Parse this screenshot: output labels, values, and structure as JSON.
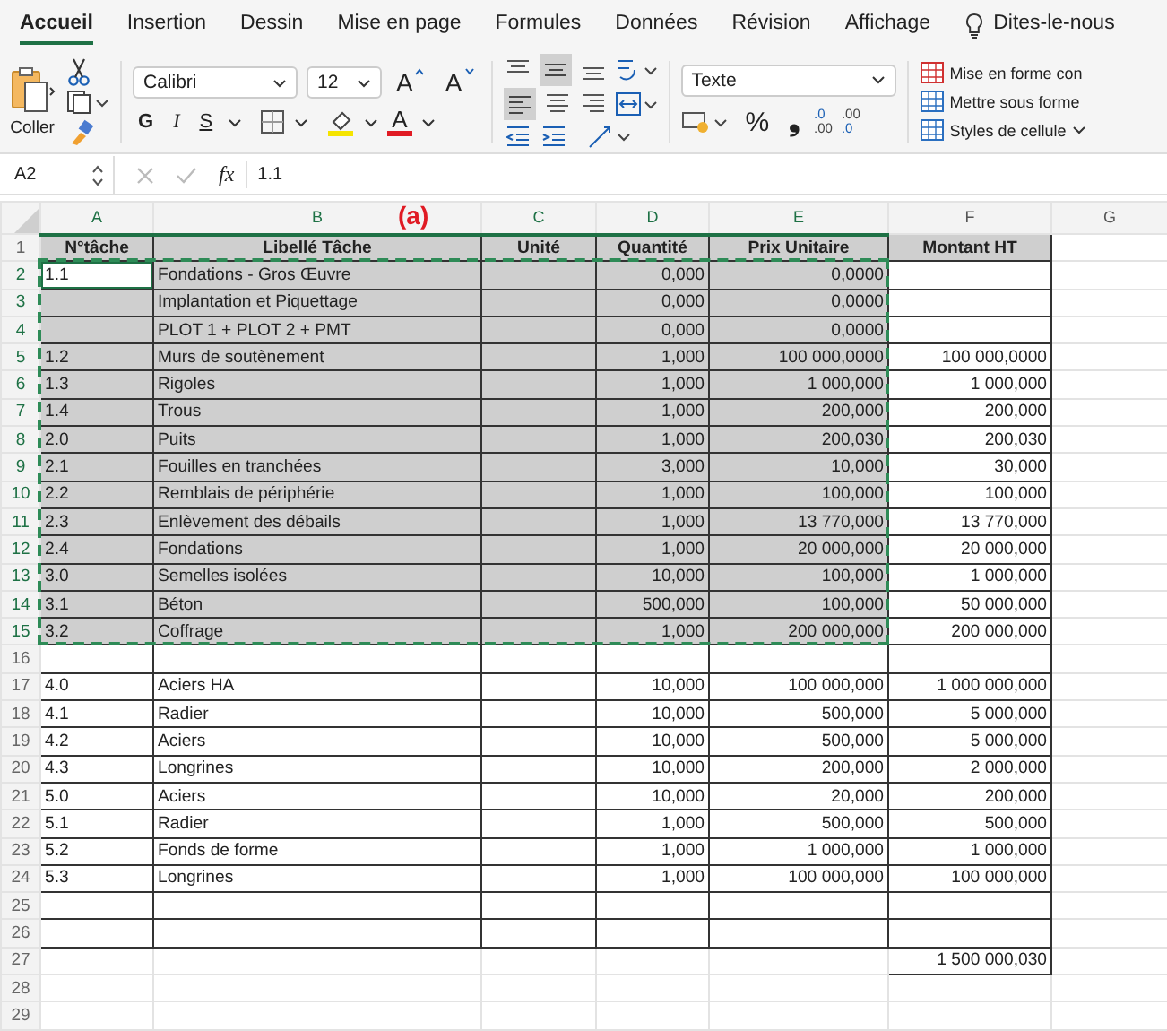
{
  "tabs": [
    {
      "label": "Accueil",
      "selected": true
    },
    {
      "label": "Insertion",
      "selected": false
    },
    {
      "label": "Dessin",
      "selected": false
    },
    {
      "label": "Mise en page",
      "selected": false
    },
    {
      "label": "Formules",
      "selected": false
    },
    {
      "label": "Données",
      "selected": false
    },
    {
      "label": "Révision",
      "selected": false
    },
    {
      "label": "Affichage",
      "selected": false
    }
  ],
  "tell_me": "Dites-le-nous",
  "ribbon": {
    "paste_label": "Coller",
    "font_name": "Calibri",
    "font_size": "12",
    "grow_font": "A",
    "shrink_font": "A",
    "bold": "G",
    "italic": "I",
    "underline": "S",
    "font_color": "A",
    "number_format": "Texte",
    "percent": "%",
    "comma_style": "❟",
    "increase_decimal": [
      ".0",
      ".00"
    ],
    "decrease_decimal": [
      ".00",
      ".0"
    ],
    "styles": [
      "Mise en forme con",
      "Mettre sous forme",
      "Styles de cellule"
    ]
  },
  "formula_bar": {
    "name_box": "A2",
    "function_label": "fx",
    "value": "1.1"
  },
  "annotation": "(a)",
  "sheet": {
    "columns": [
      {
        "letter": "A",
        "selected": true
      },
      {
        "letter": "B",
        "selected": true
      },
      {
        "letter": "C",
        "selected": true
      },
      {
        "letter": "D",
        "selected": true
      },
      {
        "letter": "E",
        "selected": true
      },
      {
        "letter": "F",
        "selected": false
      },
      {
        "letter": "G",
        "selected": false
      }
    ],
    "rows": [
      {
        "number": "1",
        "kind": "header",
        "selected": false,
        "active": false,
        "cells": [
          "N°tâche",
          "Libellé Tâche",
          "Unité",
          "Quantité",
          "Prix Unitaire",
          "Montant HT"
        ]
      },
      {
        "number": "2",
        "kind": "table",
        "selected": true,
        "active": true,
        "cells": [
          "1.1",
          "Fondations - Gros Œuvre",
          null,
          "0,000",
          "0,0000",
          null
        ]
      },
      {
        "number": "3",
        "kind": "table",
        "selected": true,
        "active": false,
        "cells": [
          null,
          "Implantation et Piquettage",
          null,
          "0,000",
          "0,0000",
          null
        ]
      },
      {
        "number": "4",
        "kind": "table",
        "selected": true,
        "active": false,
        "cells": [
          null,
          "PLOT 1 + PLOT 2 + PMT",
          null,
          "0,000",
          "0,0000",
          null
        ]
      },
      {
        "number": "5",
        "kind": "table",
        "selected": true,
        "active": false,
        "cells": [
          "1.2",
          "Murs de soutènement",
          null,
          "1,000",
          "100 000,0000",
          "100 000,0000"
        ]
      },
      {
        "number": "6",
        "kind": "table",
        "selected": true,
        "active": false,
        "cells": [
          "1.3",
          "Rigoles",
          null,
          "1,000",
          "1 000,000",
          "1 000,000"
        ]
      },
      {
        "number": "7",
        "kind": "table",
        "selected": true,
        "active": false,
        "cells": [
          "1.4",
          "Trous",
          null,
          "1,000",
          "200,000",
          "200,000"
        ]
      },
      {
        "number": "8",
        "kind": "table",
        "selected": true,
        "active": false,
        "cells": [
          "2.0",
          "Puits",
          null,
          "1,000",
          "200,030",
          "200,030"
        ]
      },
      {
        "number": "9",
        "kind": "table",
        "selected": true,
        "active": false,
        "cells": [
          "2.1",
          "Fouilles en tranchées",
          null,
          "3,000",
          "10,000",
          "30,000"
        ]
      },
      {
        "number": "10",
        "kind": "table",
        "selected": true,
        "active": false,
        "cells": [
          "2.2",
          "Remblais de périphérie",
          null,
          "1,000",
          "100,000",
          "100,000"
        ]
      },
      {
        "number": "11",
        "kind": "table",
        "selected": true,
        "active": false,
        "cells": [
          "2.3",
          "Enlèvement des débails",
          null,
          "1,000",
          "13 770,000",
          "13 770,000"
        ]
      },
      {
        "number": "12",
        "kind": "table",
        "selected": true,
        "active": false,
        "cells": [
          "2.4",
          "Fondations",
          null,
          "1,000",
          "20 000,000",
          "20 000,000"
        ]
      },
      {
        "number": "13",
        "kind": "table",
        "selected": true,
        "active": false,
        "cells": [
          "3.0",
          "Semelles isolées",
          null,
          "10,000",
          "100,000",
          "1 000,000"
        ]
      },
      {
        "number": "14",
        "kind": "table",
        "selected": true,
        "active": false,
        "cells": [
          "3.1",
          "Béton",
          null,
          "500,000",
          "100,000",
          "50 000,000"
        ]
      },
      {
        "number": "15",
        "kind": "table",
        "selected": true,
        "active": false,
        "cells": [
          "3.2",
          "Coffrage",
          null,
          "1,000",
          "200 000,000",
          "200 000,000"
        ]
      },
      {
        "number": "16",
        "kind": "table",
        "selected": false,
        "active": false,
        "cells": [
          null,
          null,
          null,
          null,
          null,
          null
        ]
      },
      {
        "number": "17",
        "kind": "table",
        "selected": false,
        "active": false,
        "cells": [
          "4.0",
          "Aciers HA",
          null,
          "10,000",
          "100 000,000",
          "1 000 000,000"
        ]
      },
      {
        "number": "18",
        "kind": "table",
        "selected": false,
        "active": false,
        "cells": [
          "4.1",
          "Radier",
          null,
          "10,000",
          "500,000",
          "5 000,000"
        ]
      },
      {
        "number": "19",
        "kind": "table",
        "selected": false,
        "active": false,
        "cells": [
          "4.2",
          "Aciers",
          null,
          "10,000",
          "500,000",
          "5 000,000"
        ]
      },
      {
        "number": "20",
        "kind": "table",
        "selected": false,
        "active": false,
        "cells": [
          "4.3",
          "Longrines",
          null,
          "10,000",
          "200,000",
          "2 000,000"
        ]
      },
      {
        "number": "21",
        "kind": "table",
        "selected": false,
        "active": false,
        "cells": [
          "5.0",
          "Aciers",
          null,
          "10,000",
          "20,000",
          "200,000"
        ]
      },
      {
        "number": "22",
        "kind": "table",
        "selected": false,
        "active": false,
        "cells": [
          "5.1",
          "Radier",
          null,
          "1,000",
          "500,000",
          "500,000"
        ]
      },
      {
        "number": "23",
        "kind": "table",
        "selected": false,
        "active": false,
        "cells": [
          "5.2",
          "Fonds de forme",
          null,
          "1,000",
          "1 000,000",
          "1 000,000"
        ]
      },
      {
        "number": "24",
        "kind": "table",
        "selected": false,
        "active": false,
        "cells": [
          "5.3",
          "Longrines",
          null,
          "1,000",
          "100 000,000",
          "100 000,000"
        ]
      },
      {
        "number": "25",
        "kind": "table",
        "selected": false,
        "active": false,
        "cells": [
          null,
          null,
          null,
          null,
          null,
          null
        ]
      },
      {
        "number": "26",
        "kind": "table",
        "selected": false,
        "active": false,
        "cells": [
          null,
          null,
          null,
          null,
          null,
          null
        ]
      },
      {
        "number": "27",
        "kind": "total",
        "selected": false,
        "active": false,
        "cells": [
          null,
          null,
          null,
          null,
          null,
          "1 500 000,030"
        ]
      },
      {
        "number": "28",
        "kind": "blank",
        "selected": false,
        "active": false
      },
      {
        "number": "29",
        "kind": "blank",
        "selected": false,
        "active": false
      }
    ]
  }
}
